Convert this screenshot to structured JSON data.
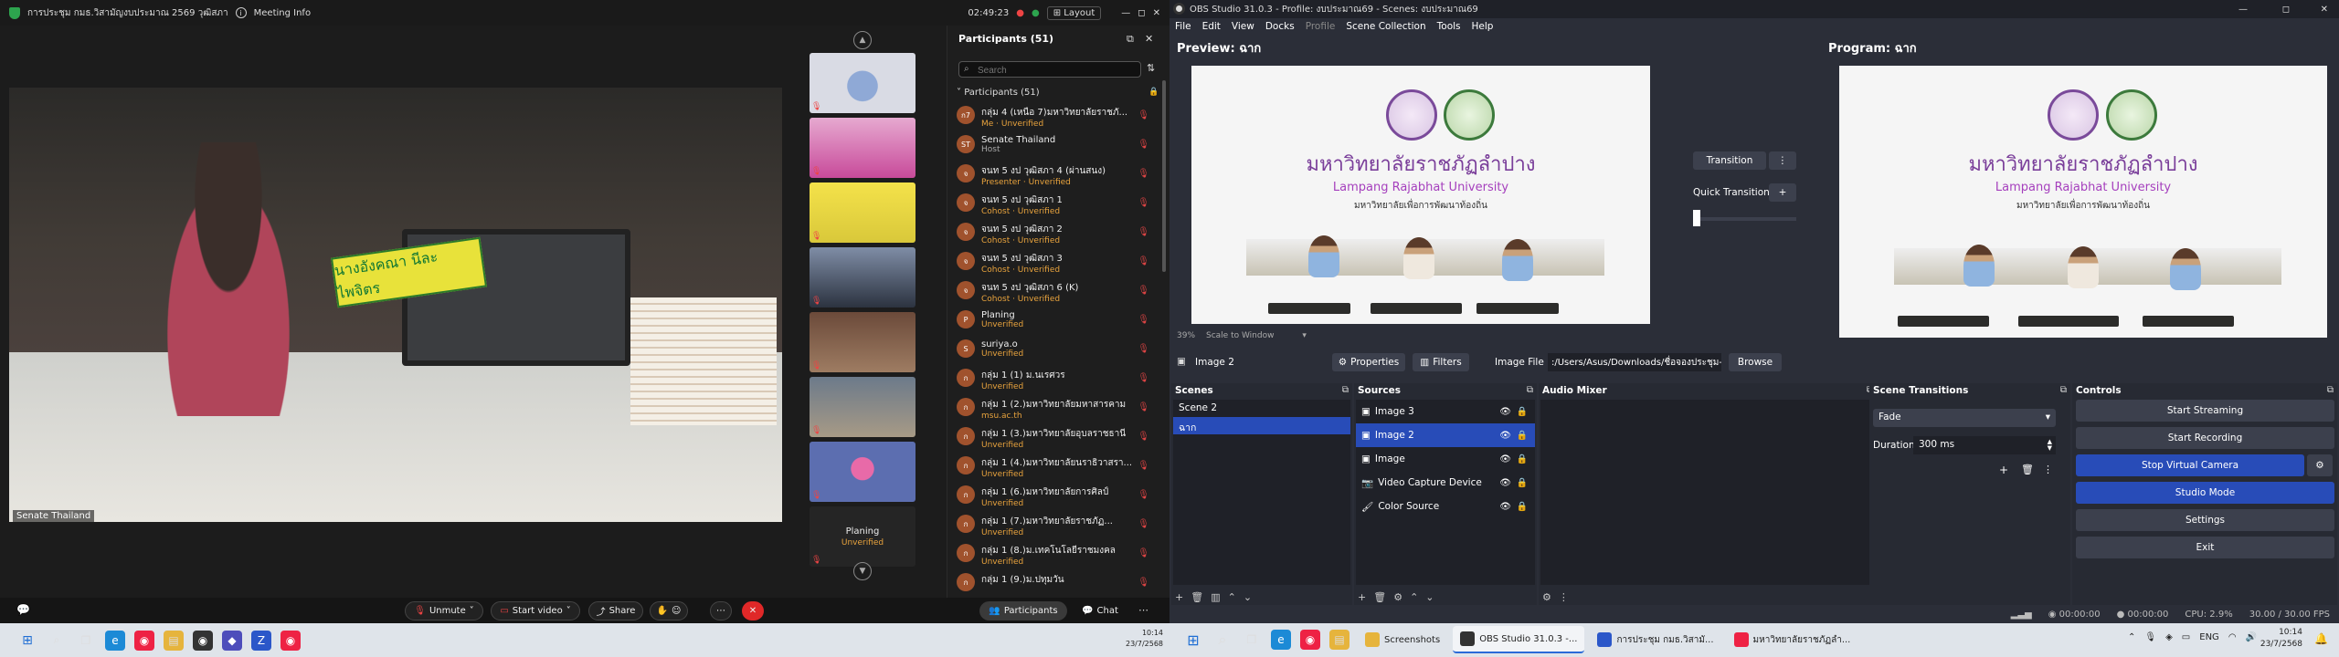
{
  "zoom": {
    "meeting_title": "การประชุม กมธ.วิสามัญงบประมาณ 2569 วุฒิสภา",
    "meeting_info": "Meeting Info",
    "timer": "02:49:23",
    "layout_label": "Layout",
    "speaker_name": "Senate Thailand",
    "nameplate_text": "นางอังคณา นีละไพจิตร",
    "strip_last_name": "Planing",
    "strip_last_status": "Unverified",
    "panel": {
      "title": "Participants (51)",
      "search_placeholder": "Search",
      "group_label": "Participants (51)",
      "rows": [
        {
          "initials": "ก7",
          "name": "กลุ่ม 4 (เหนือ 7)มหาวิทยาลัยราชภั...",
          "sub": "Me · Unverified",
          "gray": false
        },
        {
          "initials": "ST",
          "name": "Senate Thailand",
          "sub": "Host",
          "gray": true
        },
        {
          "initials": "จ",
          "name": "จนท 5 งป วุฒิสภา 4 (ผ่านสนง)",
          "sub": "Presenter · Unverified",
          "gray": false
        },
        {
          "initials": "จ",
          "name": "จนท 5 งป วุฒิสภา 1",
          "sub": "Cohost · Unverified",
          "gray": false
        },
        {
          "initials": "จ",
          "name": "จนท 5 งป วุฒิสภา 2",
          "sub": "Cohost · Unverified",
          "gray": false
        },
        {
          "initials": "จ",
          "name": "จนท 5 งป วุฒิสภา 3",
          "sub": "Cohost · Unverified",
          "gray": false
        },
        {
          "initials": "จ",
          "name": "จนท 5 งป วุฒิสภา 6 (K)",
          "sub": "Cohost · Unverified",
          "gray": false
        },
        {
          "initials": "P",
          "name": "Planing",
          "sub": "Unverified",
          "gray": false
        },
        {
          "initials": "S",
          "name": "suriya.o",
          "sub": "Unverified",
          "gray": false
        },
        {
          "initials": "ก",
          "name": "กลุ่ม 1 (1) ม.นเรศวร",
          "sub": "Unverified",
          "gray": false
        },
        {
          "initials": "ก",
          "name": "กลุ่ม 1 (2.)มหาวิทยาลัยมหาสารคาม",
          "sub": "msu.ac.th",
          "gray": false
        },
        {
          "initials": "ก",
          "name": "กลุ่ม 1 (3.)มหาวิทยาลัยอุบลราชธานี",
          "sub": "Unverified",
          "gray": false
        },
        {
          "initials": "ก",
          "name": "กลุ่ม 1 (4.)มหาวิทยาลัยนราธิวาสรา...",
          "sub": "Unverified",
          "gray": false
        },
        {
          "initials": "ก",
          "name": "กลุ่ม 1 (6.)มหาวิทยาลัยการศิลป์",
          "sub": "Unverified",
          "gray": false
        },
        {
          "initials": "ก",
          "name": "กลุ่ม 1 (7.)มหาวิทยาลัยราชภัฏ...",
          "sub": "Unverified",
          "gray": false
        },
        {
          "initials": "ก",
          "name": "กลุ่ม 1 (8.)ม.เทคโนโลยีราชมงคล",
          "sub": "Unverified",
          "gray": false
        },
        {
          "initials": "ก",
          "name": "กลุ่ม 1 (9.)ม.ปทุมวัน",
          "sub": "",
          "gray": false
        }
      ]
    },
    "bottom": {
      "unmute": "Unmute",
      "start_video": "Start video",
      "share": "Share",
      "participants": "Participants",
      "chat": "Chat"
    }
  },
  "obs": {
    "title": "OBS Studio 31.0.3 - Profile: งบประมาณ69 - Scenes: งบประมาณ69",
    "menu": [
      "File",
      "Edit",
      "View",
      "Docks",
      "Profile",
      "Scene Collection",
      "Tools",
      "Help"
    ],
    "preview_label": "Preview: ฉาก",
    "program_label": "Program: ฉาก",
    "transition_label": "Transition",
    "quick_transitions": "Quick Transitions",
    "zoom_level": "39%",
    "scale_mode": "Scale to Window",
    "canvas": {
      "uni_thai": "มหาวิทยาลัยราชภัฏลำปาง",
      "uni_en": "Lampang Rajabhat University",
      "uni_tag": "มหาวิทยาลัยเพื่อการพัฒนาท้องถิ่น"
    },
    "source_bar": {
      "selected": "Image 2",
      "properties": "Properties",
      "filters": "Filters",
      "image_file_label": "Image File",
      "image_file_path": ":/Users/Asus/Downloads/ชื่อจองประชุม-กองแผน/ชื่อผล-แผน.png",
      "browse": "Browse"
    },
    "docks": {
      "scenes_title": "Scenes",
      "scenes": [
        "Scene 2",
        "ฉาก"
      ],
      "sources_title": "Sources",
      "sources": [
        {
          "name": "Image 3",
          "icon": "image-icon"
        },
        {
          "name": "Image 2",
          "icon": "image-icon"
        },
        {
          "name": "Image",
          "icon": "image-icon"
        },
        {
          "name": "Video Capture Device",
          "icon": "camera-icon"
        },
        {
          "name": "Color Source",
          "icon": "brush-icon"
        }
      ],
      "mixer_title": "Audio Mixer",
      "transitions_title": "Scene Transitions",
      "transition_value": "Fade",
      "duration_label": "Duration",
      "duration_value": "300 ms",
      "controls_title": "Controls",
      "controls": [
        "Start Streaming",
        "Start Recording",
        "Stop Virtual Camera",
        "Studio Mode",
        "Settings",
        "Exit"
      ]
    },
    "status": {
      "rec_time": "00:00:00",
      "stream_time": "00:00:00",
      "cpu": "CPU: 2.9%",
      "fps": "30.00 / 30.00 FPS"
    }
  },
  "taskbar": {
    "apps": [
      {
        "label": "Screenshots",
        "color": "#e6b43c"
      },
      {
        "label": "OBS Studio 31.0.3 -...",
        "color": "#333"
      },
      {
        "label": "การประชุม กมธ.วิสามั...",
        "color": "#2b57c9"
      },
      {
        "label": "มหาวิทยาลัยราชภัฏลำ...",
        "color": "#e24"
      }
    ],
    "clock_small": "10:14",
    "date_small": "23/7/2568",
    "lang": "ENG",
    "clock": "10:14",
    "date": "23/7/2568"
  }
}
